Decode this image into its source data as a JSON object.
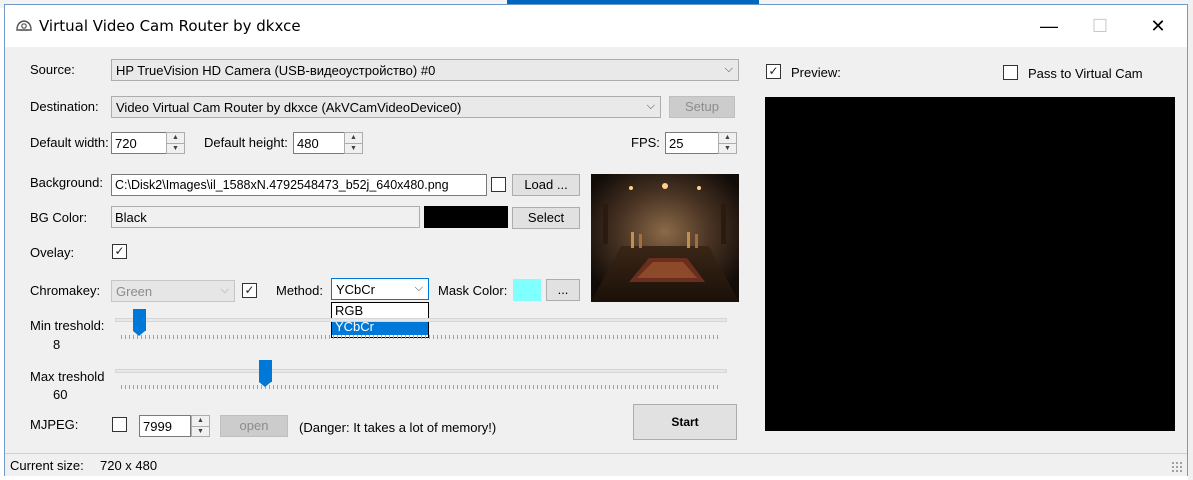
{
  "window": {
    "title": "Virtual Video Cam Router by dkxce",
    "minimize_glyph": "—",
    "maximize_glyph": "☐",
    "close_glyph": "✕"
  },
  "source": {
    "label": "Source:",
    "value": "HP TrueVision HD Camera (USB-видеоустройство) #0"
  },
  "destination": {
    "label": "Destination:",
    "value": "Video Virtual Cam Router by dkxce (AkVCamVideoDevice0)",
    "setup_label": "Setup"
  },
  "size": {
    "width_label": "Default width:",
    "width_value": "720",
    "height_label": "Default height:",
    "height_value": "480",
    "fps_label": "FPS:",
    "fps_value": "25"
  },
  "background": {
    "label": "Background:",
    "path": "C:\\Disk2\\Images\\il_1588xN.4792548473_b52j_640x480.png",
    "load_label": "Load ...",
    "checked": false
  },
  "bg_color": {
    "label": "BG Color:",
    "value": "Black",
    "swatch": "#000000",
    "select_label": "Select"
  },
  "overlay": {
    "label": "Ovelay:",
    "checked": true
  },
  "chromakey": {
    "label": "Chromakey:",
    "value": "Green",
    "checked": true,
    "method_label": "Method:",
    "method_value": "YCbCr",
    "method_options": [
      "RGB",
      "YCbCr"
    ],
    "method_selected": "YCbCr",
    "mask_color_label": "Mask Color:",
    "mask_color": "#80ffff",
    "mask_button_label": "..."
  },
  "min_threshold": {
    "label": "Min treshold:",
    "value": "8",
    "level": 0.03
  },
  "max_threshold": {
    "label": "Max treshold",
    "value": "60",
    "level": 0.24
  },
  "mjpeg": {
    "label": "MJPEG:",
    "checked": false,
    "port": "7999",
    "open_label": "open",
    "warning": "(Danger: It takes a lot of memory!)"
  },
  "start_label": "Start",
  "preview": {
    "label": "Preview:",
    "checked": true,
    "pass_label": "Pass to Virtual Cam",
    "pass_checked": false
  },
  "status": {
    "label": "Current size:",
    "value": "720 x 480"
  },
  "colors": {
    "accent": "#0078d7",
    "preview_bg": "#000000",
    "window_bg": "#f0f0f0"
  }
}
